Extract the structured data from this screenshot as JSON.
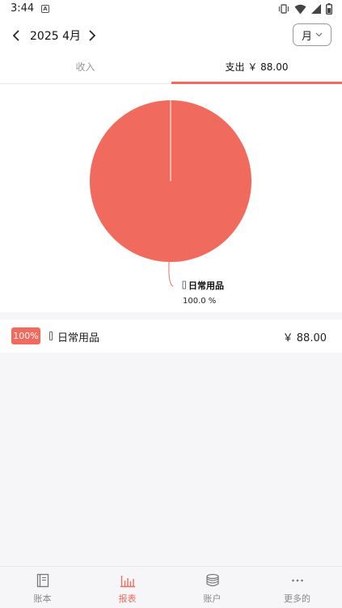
{
  "status_bar": {
    "time": "3:44",
    "notification_glyph": "A",
    "icons": [
      "vibrate-icon",
      "wifi-icon",
      "signal-icon",
      "battery-icon"
    ]
  },
  "header": {
    "date": "2025 4月",
    "period": "月"
  },
  "tabs": [
    {
      "label": "收入",
      "active": false
    },
    {
      "label": "支出  ￥ 88.00",
      "active": true
    }
  ],
  "chart_data": {
    "type": "pie",
    "slices": [
      {
        "label": "日常用品",
        "value": 88.0,
        "percent": "100.0 %"
      }
    ],
    "color": "#f06a5e"
  },
  "categories": [
    {
      "percent": "100%",
      "name": "日常用品",
      "amount": "￥ 88.00"
    }
  ],
  "bottom_nav": [
    {
      "label": "账本",
      "icon": "book-icon",
      "active": false
    },
    {
      "label": "报表",
      "icon": "bar-chart-icon",
      "active": true
    },
    {
      "label": "账户",
      "icon": "coins-icon",
      "active": false
    },
    {
      "label": "更多的",
      "icon": "more-icon",
      "active": false
    }
  ],
  "colors": {
    "accent": "#f06a5e",
    "inactive": "#888888"
  }
}
